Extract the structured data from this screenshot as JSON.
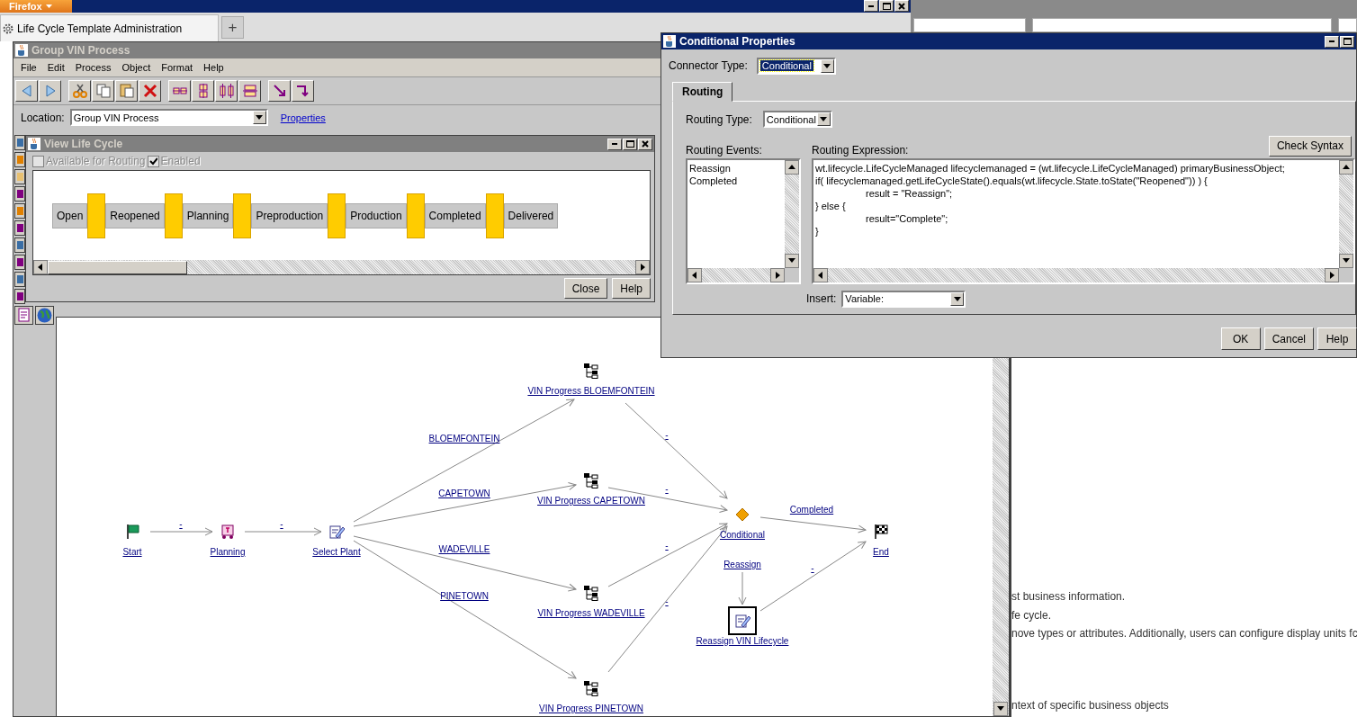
{
  "browser": {
    "menu_button": "Firefox",
    "tabs": [
      {
        "title": "Life Cycle Template Administration",
        "selected": true
      }
    ],
    "new_tab": "+"
  },
  "process_window": {
    "title": "Group VIN Process",
    "active": false,
    "menu": [
      "File",
      "Edit",
      "Process",
      "Object",
      "Format",
      "Help"
    ],
    "location_label": "Location:",
    "location": "Group VIN Process",
    "properties_link": "Properties"
  },
  "diagram": {
    "nodes": [
      {
        "label": "Start",
        "kind": "start",
        "selected": false
      },
      {
        "label": "Planning",
        "kind": "activity",
        "selected": false
      },
      {
        "label": "Select Plant",
        "kind": "assign",
        "selected": false
      },
      {
        "label": "VIN Progress BLOEMFONTEIN",
        "kind": "subprocess",
        "selected": false
      },
      {
        "label": "VIN Progress CAPETOWN",
        "kind": "subprocess",
        "selected": false
      },
      {
        "label": "VIN Progress WADEVILLE",
        "kind": "subprocess",
        "selected": false
      },
      {
        "label": "VIN Progress PINETOWN",
        "kind": "subprocess",
        "selected": false
      },
      {
        "label": "Conditional",
        "kind": "connector",
        "selected": false
      },
      {
        "label": "End",
        "kind": "end",
        "selected": false
      },
      {
        "label": "Reassign VIN Lifecycle",
        "kind": "assign",
        "selected": true
      }
    ],
    "links": [
      {
        "label": "-"
      },
      {
        "label": "-"
      },
      {
        "label": "BLOEMFONTEIN"
      },
      {
        "label": "CAPETOWN"
      },
      {
        "label": "WADEVILLE"
      },
      {
        "label": "PINETOWN"
      },
      {
        "label": "-"
      },
      {
        "label": "-"
      },
      {
        "label": "-"
      },
      {
        "label": "-"
      },
      {
        "label": "Completed"
      },
      {
        "label": "Reassign"
      },
      {
        "label": "-"
      }
    ]
  },
  "lifecycle_window": {
    "title": "View Life Cycle",
    "active": false,
    "options": [
      {
        "label": "Available for Routing",
        "checked": false,
        "disabled": true
      },
      {
        "label": "Enabled",
        "checked": true,
        "disabled": true
      }
    ],
    "states": [
      "Open",
      "Reopened",
      "Planning",
      "Preproduction",
      "Production",
      "Completed",
      "Delivered"
    ],
    "buttons": [
      "Close",
      "Help"
    ]
  },
  "conditional_window": {
    "title": "Conditional Properties",
    "active": true,
    "connector_type_label": "Connector Type:",
    "connector_type": "Conditional",
    "tabs": [
      {
        "label": "Routing",
        "selected": true
      }
    ],
    "routing_type_label": "Routing Type:",
    "routing_type": "Conditional",
    "events_label": "Routing Events:",
    "events": [
      "Reassign",
      "Completed"
    ],
    "expression_label": "Routing Expression:",
    "check_syntax": "Check Syntax",
    "expression": [
      "wt.lifecycle.LifeCycleManaged lifecyclemanaged = (wt.lifecycle.LifeCycleManaged) primaryBusinessObject;",
      "if( lifecyclemanaged.getLifeCycleState().equals(wt.lifecycle.State.toState(\"Reopened\")) ) {",
      "\tresult = \"Reassign\";",
      "} else {",
      "\tresult=\"Complete\";",
      "}"
    ],
    "insert_label": "Insert:",
    "insert": "Variable:",
    "buttons": [
      "OK",
      "Cancel",
      "Help"
    ]
  },
  "background_page": {
    "lines": [
      "st business information.",
      "fe cycle.",
      "nove types or attributes. Additionally, users can configure display units fc",
      "ntext of specific business objects"
    ]
  }
}
